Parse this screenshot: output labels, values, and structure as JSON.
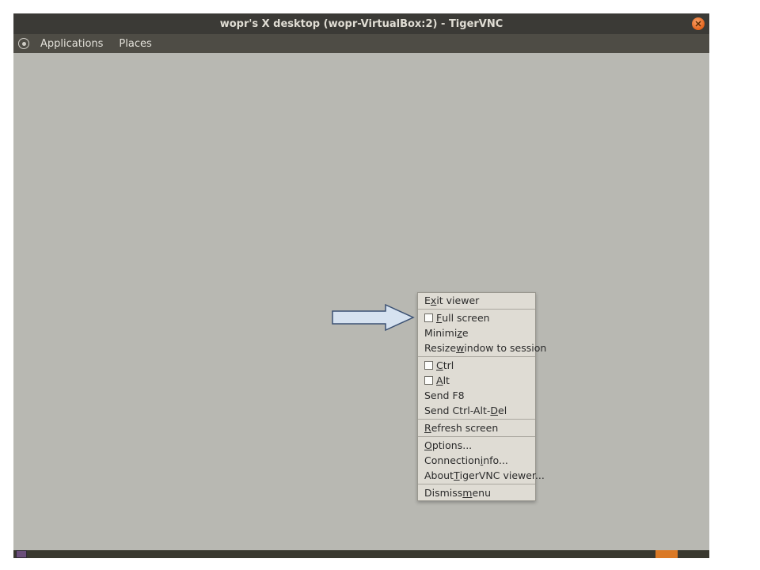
{
  "titlebar": {
    "title": "wopr's X desktop (wopr-VirtualBox:2) - TigerVNC"
  },
  "menubar": {
    "applications": "Applications",
    "places": "Places"
  },
  "context_menu": {
    "exit_pre": "E",
    "exit_u": "x",
    "exit_post": "it viewer",
    "full_pre": "",
    "full_u": "F",
    "full_post": "ull screen",
    "min_pre": "Minimi",
    "min_u": "z",
    "min_post": "e",
    "resize_pre": "Resize ",
    "resize_u": "w",
    "resize_post": "indow to session",
    "ctrl_pre": "",
    "ctrl_u": "C",
    "ctrl_post": "trl",
    "alt_pre": "",
    "alt_u": "A",
    "alt_post": "lt",
    "sendf8": "Send F8",
    "cad_pre": "Send Ctrl-Alt-",
    "cad_u": "D",
    "cad_post": "el",
    "refresh_pre": "",
    "refresh_u": "R",
    "refresh_post": "efresh screen",
    "options_pre": "",
    "options_u": "O",
    "options_post": "ptions...",
    "conninfo_pre": "Connection ",
    "conninfo_u": "i",
    "conninfo_post": "nfo...",
    "about_pre": "About ",
    "about_u": "T",
    "about_post": "igerVNC viewer...",
    "dismiss_pre": "Dismiss ",
    "dismiss_u": "m",
    "dismiss_post": "enu"
  }
}
